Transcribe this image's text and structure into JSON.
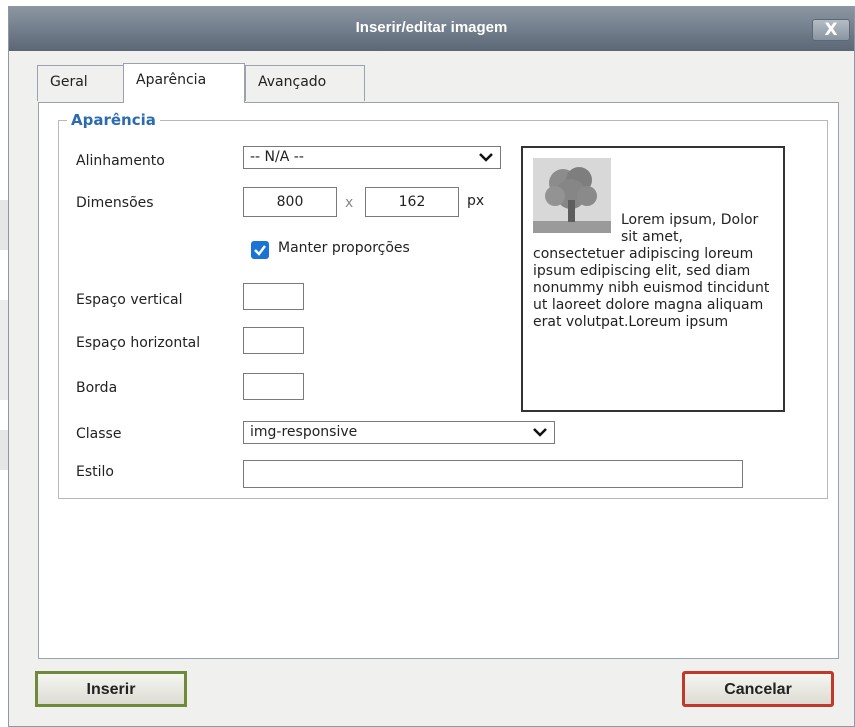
{
  "window": {
    "title": "Inserir/editar imagem",
    "close_label": "X"
  },
  "tabs": [
    {
      "label": "Geral",
      "active": false
    },
    {
      "label": "Aparência",
      "active": true
    },
    {
      "label": "Avançado",
      "active": false
    }
  ],
  "appearance": {
    "legend": "Aparência",
    "alignment": {
      "label": "Alinhamento",
      "value": "-- N/A --"
    },
    "dimensions": {
      "label": "Dimensões",
      "width": "800",
      "separator": "x",
      "height": "162",
      "unit": "px"
    },
    "keep_proportions": {
      "label": "Manter proporções",
      "checked": true
    },
    "vertical_space": {
      "label": "Espaço vertical",
      "value": ""
    },
    "horizontal_space": {
      "label": "Espaço horizontal",
      "value": ""
    },
    "border": {
      "label": "Borda",
      "value": ""
    },
    "class": {
      "label": "Classe",
      "value": "img-responsive"
    },
    "style": {
      "label": "Estilo",
      "value": ""
    },
    "preview_text": "Lorem ipsum, Dolor sit amet, consectetuer adipiscing loreum ipsum edipiscing elit, sed diam nonummy nibh euismod tincidunt ut laoreet dolore magna aliquam erat volutpat.Loreum ipsum"
  },
  "footer": {
    "insert_label": "Inserir",
    "cancel_label": "Cancelar"
  },
  "colors": {
    "accent": "#2b6bb0",
    "checkbox": "#1b73d6",
    "insert_border": "#6f8a3a",
    "cancel_border": "#c0392b"
  }
}
